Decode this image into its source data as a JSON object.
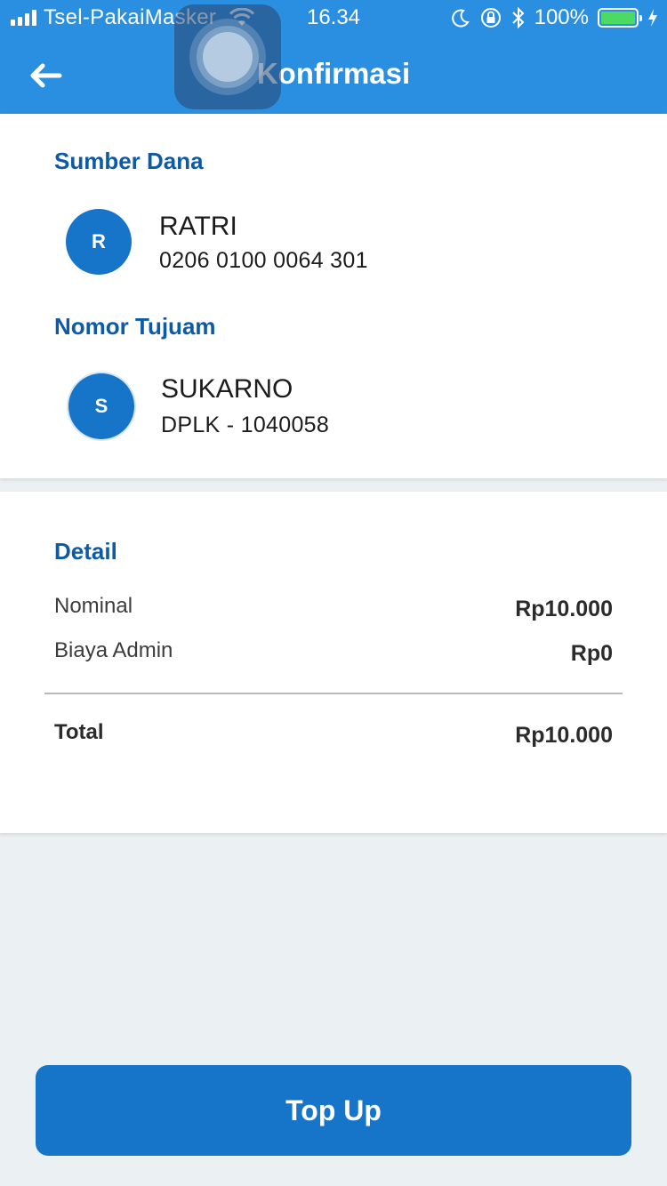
{
  "status_bar": {
    "carrier": "Tsel-PakaiMasker",
    "time": "16.34",
    "battery": "100%",
    "battery_level": 1.0
  },
  "header": {
    "title": "Konfirmasi",
    "back_icon": "arrow-left-icon"
  },
  "source": {
    "section_title": "Sumber Dana",
    "initial": "R",
    "name": "RATRI",
    "account": "0206 0100 0064 301"
  },
  "destination": {
    "section_title": "Nomor Tujuam",
    "initial": "S",
    "name": "SUKARNO",
    "account": "DPLK - 1040058"
  },
  "detail": {
    "section_title": "Detail",
    "rows": [
      {
        "label": "Nominal",
        "value": "Rp10.000"
      },
      {
        "label": "Biaya Admin",
        "value": "Rp0"
      }
    ],
    "total_label": "Total",
    "total_value": "Rp10.000"
  },
  "action": {
    "topup_label": "Top Up"
  },
  "colors": {
    "header": "#2a8fe0",
    "accent": "#1674c9",
    "section_title": "#0d5aa7",
    "background": "#ebf0f3"
  }
}
